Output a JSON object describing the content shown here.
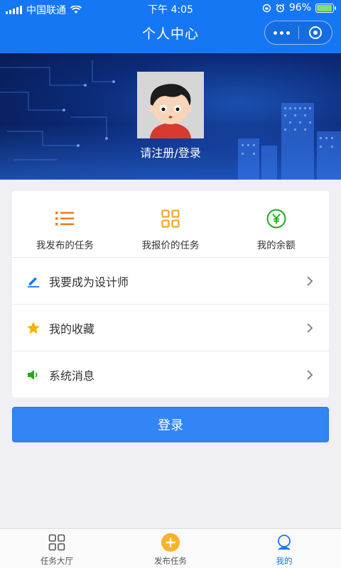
{
  "status_bar": {
    "carrier": "中国联通",
    "time": "下午 4:05",
    "battery": "96%",
    "battery_level": 0.96
  },
  "nav": {
    "title": "个人中心",
    "more_icon": "more-dots-icon",
    "close_icon": "target-circle-icon"
  },
  "profile": {
    "login_hint": "请注册/登录",
    "avatar_icon": "cartoon-boy-avatar"
  },
  "quick_actions": [
    {
      "label": "我发布的任务",
      "icon": "list-icon",
      "color": "#f07a1c"
    },
    {
      "label": "我报价的任务",
      "icon": "grid-icon",
      "color": "#f5a623"
    },
    {
      "label": "我的余额",
      "icon": "yuan-circle-icon",
      "color": "#1aad19"
    }
  ],
  "menu": [
    {
      "label": "我要成为设计师",
      "icon": "pen-icon",
      "color": "#1677f5"
    },
    {
      "label": "我的收藏",
      "icon": "star-icon",
      "color": "#f5b400"
    },
    {
      "label": "系统消息",
      "icon": "speaker-icon",
      "color": "#1aad19"
    }
  ],
  "login_button": {
    "label": "登录"
  },
  "tabbar": [
    {
      "label": "任务大厅",
      "icon": "grid-outline-icon",
      "active": false
    },
    {
      "label": "发布任务",
      "icon": "plus-circle-icon",
      "active": false
    },
    {
      "label": "我的",
      "icon": "user-icon",
      "active": true
    }
  ],
  "colors": {
    "primary": "#1677f5",
    "button": "#3384f5",
    "background": "#efeff4"
  }
}
